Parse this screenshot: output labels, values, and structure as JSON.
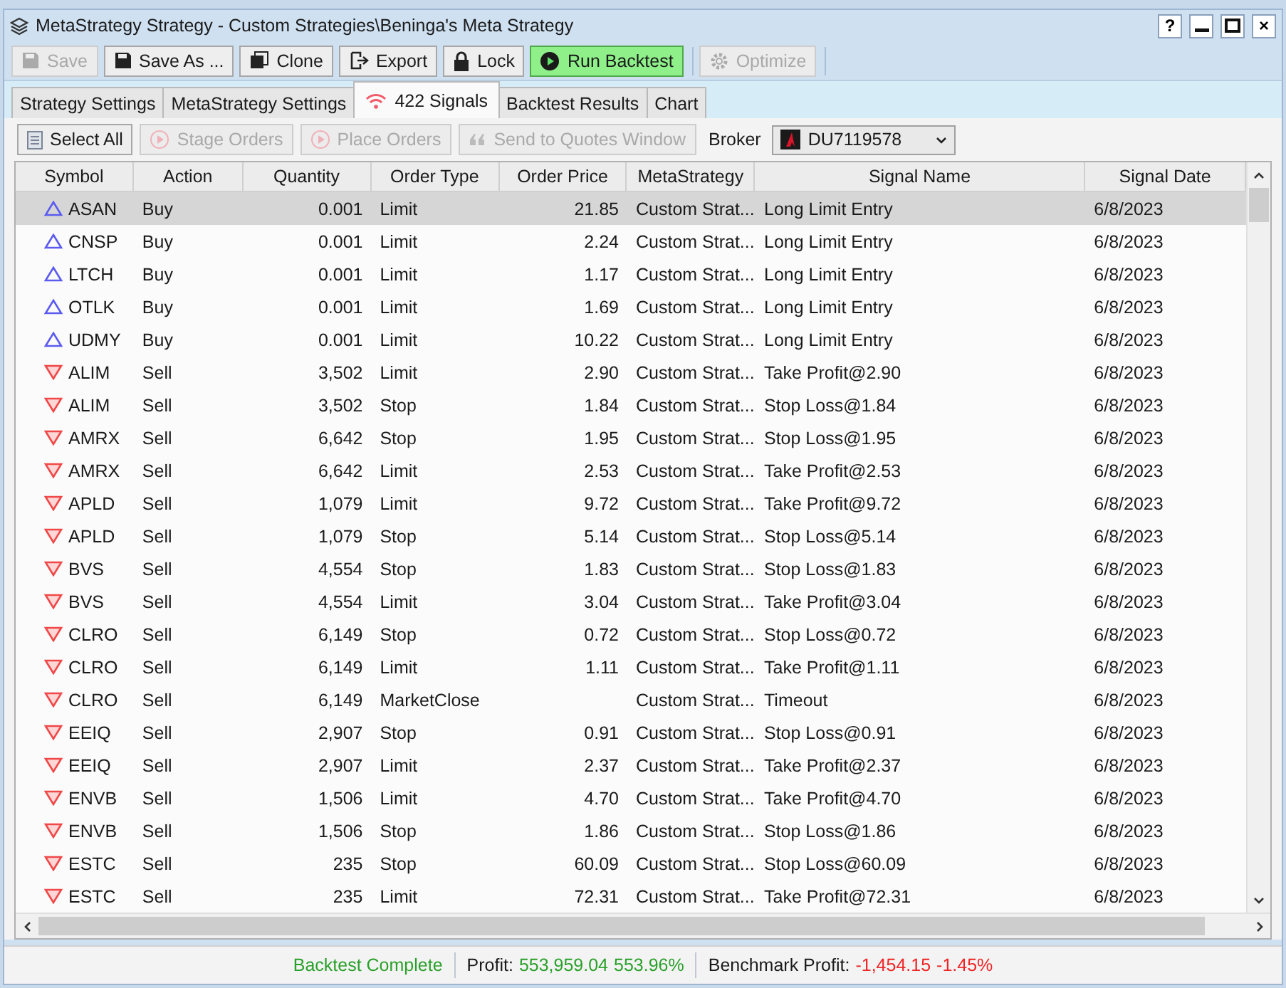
{
  "window": {
    "title": "MetaStrategy Strategy - Custom Strategies\\Beninga's Meta Strategy",
    "help": "?",
    "close": "×"
  },
  "toolbar": [
    {
      "label": "Save",
      "disabled": true,
      "kind": "normal"
    },
    {
      "label": "Save As ...",
      "disabled": false,
      "kind": "normal"
    },
    {
      "label": "Clone",
      "disabled": false,
      "kind": "normal"
    },
    {
      "label": "Export",
      "disabled": false,
      "kind": "normal"
    },
    {
      "label": "Lock",
      "disabled": false,
      "kind": "normal"
    },
    {
      "label": "Run Backtest",
      "disabled": false,
      "kind": "primary"
    },
    {
      "label": "Optimize",
      "disabled": true,
      "kind": "normal"
    }
  ],
  "tabs": [
    {
      "label": "Strategy Settings",
      "selected": false
    },
    {
      "label": "MetaStrategy Settings",
      "selected": false
    },
    {
      "label": "422 Signals",
      "selected": true
    },
    {
      "label": "Backtest Results",
      "selected": false
    },
    {
      "label": "Chart",
      "selected": false
    }
  ],
  "signal_toolbar": {
    "buttons": [
      {
        "label": "Select All",
        "disabled": false
      },
      {
        "label": "Stage Orders",
        "disabled": true
      },
      {
        "label": "Place Orders",
        "disabled": true
      },
      {
        "label": "Send to Quotes Window",
        "disabled": true
      }
    ],
    "broker_label": "Broker",
    "broker": "DU7119578"
  },
  "table": {
    "columns": [
      "Symbol",
      "Action",
      "Quantity",
      "Order Type",
      "Order Price",
      "MetaStrategy",
      "Signal Name",
      "Signal Date"
    ],
    "rows": [
      {
        "kind": "buy",
        "selected": true,
        "cells": [
          "ASAN",
          "Buy",
          "0.001",
          "Limit",
          "21.85",
          "Custom Strat...",
          "Long Limit Entry",
          "6/8/2023"
        ]
      },
      {
        "kind": "buy",
        "selected": false,
        "cells": [
          "CNSP",
          "Buy",
          "0.001",
          "Limit",
          "2.24",
          "Custom Strat...",
          "Long Limit Entry",
          "6/8/2023"
        ]
      },
      {
        "kind": "buy",
        "selected": false,
        "cells": [
          "LTCH",
          "Buy",
          "0.001",
          "Limit",
          "1.17",
          "Custom Strat...",
          "Long Limit Entry",
          "6/8/2023"
        ]
      },
      {
        "kind": "buy",
        "selected": false,
        "cells": [
          "OTLK",
          "Buy",
          "0.001",
          "Limit",
          "1.69",
          "Custom Strat...",
          "Long Limit Entry",
          "6/8/2023"
        ]
      },
      {
        "kind": "buy",
        "selected": false,
        "cells": [
          "UDMY",
          "Buy",
          "0.001",
          "Limit",
          "10.22",
          "Custom Strat...",
          "Long Limit Entry",
          "6/8/2023"
        ]
      },
      {
        "kind": "sell",
        "selected": false,
        "cells": [
          "ALIM",
          "Sell",
          "3,502",
          "Limit",
          "2.90",
          "Custom Strat...",
          "Take Profit@2.90",
          "6/8/2023"
        ]
      },
      {
        "kind": "sell",
        "selected": false,
        "cells": [
          "ALIM",
          "Sell",
          "3,502",
          "Stop",
          "1.84",
          "Custom Strat...",
          "Stop Loss@1.84",
          "6/8/2023"
        ]
      },
      {
        "kind": "sell",
        "selected": false,
        "cells": [
          "AMRX",
          "Sell",
          "6,642",
          "Stop",
          "1.95",
          "Custom Strat...",
          "Stop Loss@1.95",
          "6/8/2023"
        ]
      },
      {
        "kind": "sell",
        "selected": false,
        "cells": [
          "AMRX",
          "Sell",
          "6,642",
          "Limit",
          "2.53",
          "Custom Strat...",
          "Take Profit@2.53",
          "6/8/2023"
        ]
      },
      {
        "kind": "sell",
        "selected": false,
        "cells": [
          "APLD",
          "Sell",
          "1,079",
          "Limit",
          "9.72",
          "Custom Strat...",
          "Take Profit@9.72",
          "6/8/2023"
        ]
      },
      {
        "kind": "sell",
        "selected": false,
        "cells": [
          "APLD",
          "Sell",
          "1,079",
          "Stop",
          "5.14",
          "Custom Strat...",
          "Stop Loss@5.14",
          "6/8/2023"
        ]
      },
      {
        "kind": "sell",
        "selected": false,
        "cells": [
          "BVS",
          "Sell",
          "4,554",
          "Stop",
          "1.83",
          "Custom Strat...",
          "Stop Loss@1.83",
          "6/8/2023"
        ]
      },
      {
        "kind": "sell",
        "selected": false,
        "cells": [
          "BVS",
          "Sell",
          "4,554",
          "Limit",
          "3.04",
          "Custom Strat...",
          "Take Profit@3.04",
          "6/8/2023"
        ]
      },
      {
        "kind": "sell",
        "selected": false,
        "cells": [
          "CLRO",
          "Sell",
          "6,149",
          "Stop",
          "0.72",
          "Custom Strat...",
          "Stop Loss@0.72",
          "6/8/2023"
        ]
      },
      {
        "kind": "sell",
        "selected": false,
        "cells": [
          "CLRO",
          "Sell",
          "6,149",
          "Limit",
          "1.11",
          "Custom Strat...",
          "Take Profit@1.11",
          "6/8/2023"
        ]
      },
      {
        "kind": "sell",
        "selected": false,
        "cells": [
          "CLRO",
          "Sell",
          "6,149",
          "MarketClose",
          "",
          "Custom Strat...",
          "Timeout",
          "6/8/2023"
        ]
      },
      {
        "kind": "sell",
        "selected": false,
        "cells": [
          "EEIQ",
          "Sell",
          "2,907",
          "Stop",
          "0.91",
          "Custom Strat...",
          "Stop Loss@0.91",
          "6/8/2023"
        ]
      },
      {
        "kind": "sell",
        "selected": false,
        "cells": [
          "EEIQ",
          "Sell",
          "2,907",
          "Limit",
          "2.37",
          "Custom Strat...",
          "Take Profit@2.37",
          "6/8/2023"
        ]
      },
      {
        "kind": "sell",
        "selected": false,
        "cells": [
          "ENVB",
          "Sell",
          "1,506",
          "Limit",
          "4.70",
          "Custom Strat...",
          "Take Profit@4.70",
          "6/8/2023"
        ]
      },
      {
        "kind": "sell",
        "selected": false,
        "cells": [
          "ENVB",
          "Sell",
          "1,506",
          "Stop",
          "1.86",
          "Custom Strat...",
          "Stop Loss@1.86",
          "6/8/2023"
        ]
      },
      {
        "kind": "sell",
        "selected": false,
        "cells": [
          "ESTC",
          "Sell",
          "235",
          "Stop",
          "60.09",
          "Custom Strat...",
          "Stop Loss@60.09",
          "6/8/2023"
        ]
      },
      {
        "kind": "sell",
        "selected": false,
        "cells": [
          "ESTC",
          "Sell",
          "235",
          "Limit",
          "72.31",
          "Custom Strat...",
          "Take Profit@72.31",
          "6/8/2023"
        ]
      }
    ]
  },
  "status_bar": [
    {
      "kind": "status",
      "text": "Backtest Complete"
    },
    {
      "kind": "metric",
      "label": "Profit:",
      "positive": true,
      "values": [
        "553,959.04",
        "553.96%"
      ]
    },
    {
      "kind": "metric",
      "label": "Benchmark Profit:",
      "positive": false,
      "values": [
        "-1,454.15",
        "-1.45%"
      ]
    }
  ]
}
